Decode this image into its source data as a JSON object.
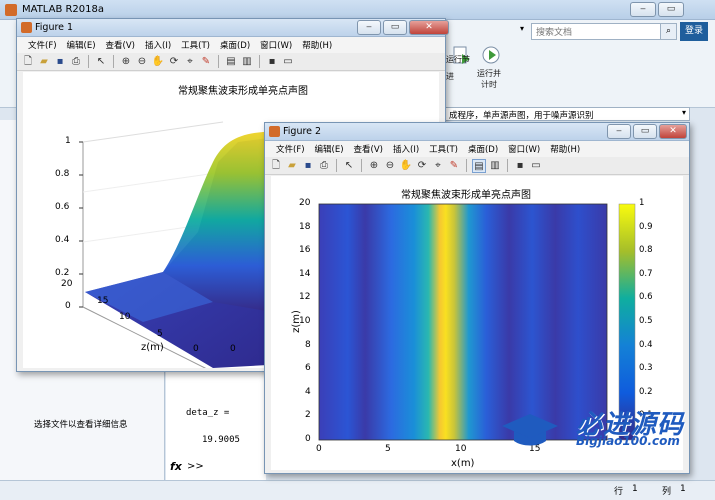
{
  "main": {
    "title": "MATLAB R2018a",
    "search_placeholder": "搜索文档",
    "login_label": "登录",
    "ribbon": {
      "run_section": "运行节",
      "advance": "进",
      "run_time": "运行并\n计时"
    },
    "path_bar": "成程序，单声源声图，用于噪声源识别",
    "left_panel_text": "选择文件以查看详细信息",
    "command_window": {
      "line1": "deta_z =",
      "line2": "19.9005",
      "prompt": ">>"
    },
    "fx_label": "fx",
    "status": {
      "row_label": "行",
      "row_value": "1",
      "col_label": "列",
      "col_value": "1"
    }
  },
  "figure1": {
    "title": "Figure 1",
    "menus": [
      "文件(F)",
      "编辑(E)",
      "查看(V)",
      "插入(I)",
      "工具(T)",
      "桌面(D)",
      "窗口(W)",
      "帮助(H)"
    ],
    "plot_title": "常规聚焦波束形成单亮点声图",
    "z_ticks": [
      "1",
      "0.8",
      "0.6",
      "0.4",
      "0.2",
      "0"
    ],
    "y_ticks": [
      "20",
      "15",
      "10",
      "5",
      "0"
    ],
    "x_label": "z(m)",
    "x_ticks": [
      "0"
    ]
  },
  "figure2": {
    "title": "Figure 2",
    "menus": [
      "文件(F)",
      "编辑(E)",
      "查看(V)",
      "插入(I)",
      "工具(T)",
      "桌面(D)",
      "窗口(W)",
      "帮助(H)"
    ],
    "plot_title": "常规聚焦波束形成单亮点声图",
    "y_label": "z(m)",
    "x_label": "x(m)",
    "y_ticks": [
      "20",
      "18",
      "16",
      "14",
      "12",
      "10",
      "8",
      "6",
      "4",
      "2",
      "0"
    ],
    "x_ticks": [
      "0",
      "5",
      "10",
      "15"
    ],
    "colorbar_ticks": [
      "1",
      "0.9",
      "0.8",
      "0.7",
      "0.6",
      "0.5",
      "0.4",
      "0.3",
      "0.2",
      "0.1"
    ]
  },
  "watermark": {
    "cn": "必进源码",
    "en": "Bigjiao100.com"
  },
  "colors": {
    "parula_low": "#352a87",
    "parula_mid": "#0fae9f",
    "parula_high": "#f9fb0e"
  }
}
